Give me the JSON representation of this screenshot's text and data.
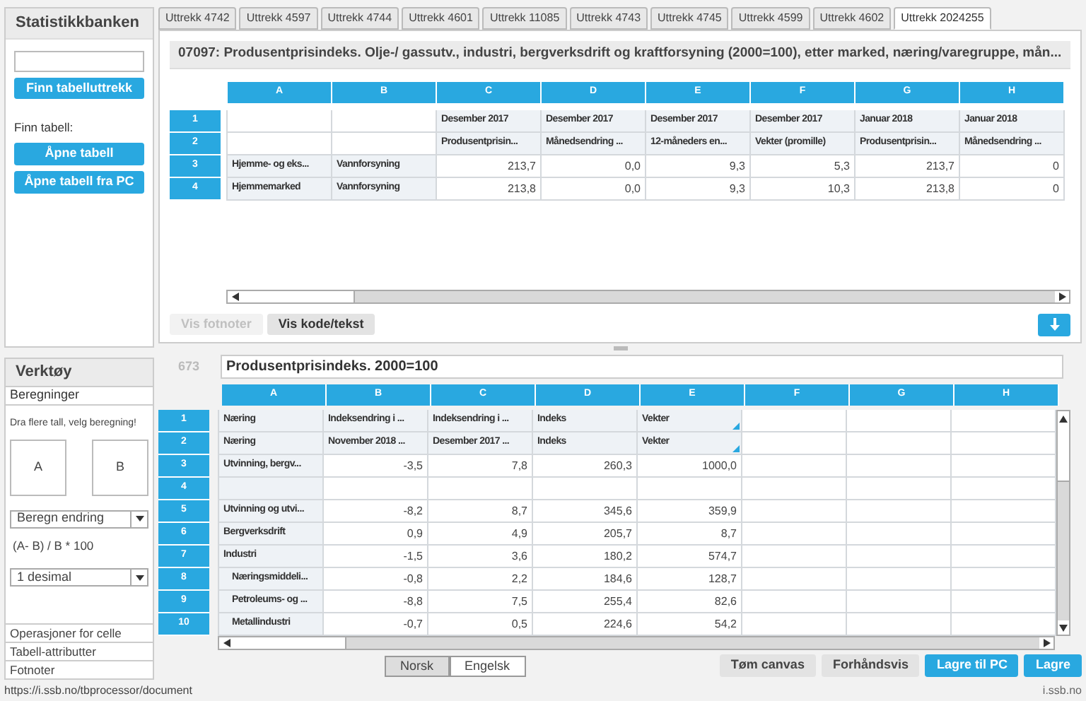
{
  "sidebar": {
    "title": "Statistikkbanken",
    "find_button": "Finn tabelluttrekk",
    "find_label": "Finn tabell:",
    "buttons": [
      "Åpne tabell",
      "Åpne tabell fra PC"
    ]
  },
  "tabs": [
    {
      "label": "Uttrekk 4742",
      "selected": false
    },
    {
      "label": "Uttrekk 4597",
      "selected": false
    },
    {
      "label": "Uttrekk 4744",
      "selected": false
    },
    {
      "label": "Uttrekk 4601",
      "selected": false
    },
    {
      "label": "Uttrekk 11085",
      "selected": false
    },
    {
      "label": "Uttrekk 4743",
      "selected": false
    },
    {
      "label": "Uttrekk 4745",
      "selected": false
    },
    {
      "label": "Uttrekk 4599",
      "selected": false
    },
    {
      "label": "Uttrekk 4602",
      "selected": false
    },
    {
      "label": "Uttrekk 2024255",
      "selected": true
    }
  ],
  "top_table": {
    "title": "07097: Produsentprisindeks. Olje-/ gassutv., industri, bergverksdrift og kraftforsyning (2000=100), etter marked, næring/varegruppe, mån...",
    "columns": [
      "A",
      "B",
      "C",
      "D",
      "E",
      "F",
      "G",
      "H"
    ],
    "rows": [
      {
        "number": "1",
        "cells": [
          null,
          null,
          {
            "kind": "head",
            "text": "Desember 2017"
          },
          {
            "kind": "head",
            "text": "Desember 2017"
          },
          {
            "kind": "head",
            "text": "Desember 2017"
          },
          {
            "kind": "head",
            "text": "Desember 2017"
          },
          {
            "kind": "head",
            "text": "Januar 2018"
          },
          {
            "kind": "head",
            "text": "Januar 2018"
          }
        ]
      },
      {
        "number": "2",
        "cells": [
          null,
          null,
          {
            "kind": "head",
            "text": "Produsentprisin..."
          },
          {
            "kind": "head",
            "text": "Månedsendring ..."
          },
          {
            "kind": "head",
            "text": "12-måneders en..."
          },
          {
            "kind": "head",
            "text": "Vekter (promille)"
          },
          {
            "kind": "head",
            "text": "Produsentprisin..."
          },
          {
            "kind": "head",
            "text": "Månedsendring ..."
          }
        ]
      },
      {
        "number": "3",
        "cells": [
          {
            "kind": "head",
            "text": "Hjemme- og eks..."
          },
          {
            "kind": "head",
            "text": "Vannforsyning"
          },
          {
            "kind": "num",
            "text": "213,7"
          },
          {
            "kind": "num",
            "text": "0,0"
          },
          {
            "kind": "num",
            "text": "9,3"
          },
          {
            "kind": "num",
            "text": "5,3"
          },
          {
            "kind": "num",
            "text": "213,7"
          },
          {
            "kind": "num",
            "text": "0"
          }
        ]
      },
      {
        "number": "4",
        "cells": [
          {
            "kind": "head",
            "text": "Hjemmemarked"
          },
          {
            "kind": "head",
            "text": "Vannforsyning"
          },
          {
            "kind": "num",
            "text": "213,8"
          },
          {
            "kind": "num",
            "text": "0,0"
          },
          {
            "kind": "num",
            "text": "9,3"
          },
          {
            "kind": "num",
            "text": "10,3"
          },
          {
            "kind": "num",
            "text": "213,8"
          },
          {
            "kind": "num",
            "text": "0"
          }
        ]
      }
    ],
    "buttons": [
      {
        "label": "Vis fotnoter",
        "disabled": true
      },
      {
        "label": "Vis kode/tekst",
        "disabled": false
      }
    ]
  },
  "tools": {
    "title": "Verktøy",
    "section": "Beregninger",
    "hint": "Dra flere tall, velg beregning!",
    "drop_boxes": [
      "A",
      "B"
    ],
    "operation": "Beregn endring",
    "formula": "(A- B) / B * 100",
    "decimals": "1 desimal",
    "sections": [
      "Operasjoner for celle",
      "Tabell-attributter",
      "Fotnoter"
    ]
  },
  "canvas": {
    "row_count": "673",
    "title": "Produsentprisindeks. 2000=100",
    "columns": [
      "A",
      "B",
      "C",
      "D",
      "E",
      "F",
      "G",
      "H"
    ],
    "rows": [
      {
        "number": "1",
        "cells": [
          {
            "kind": "head",
            "text": "Næring"
          },
          {
            "kind": "head",
            "text": "Indeksendring i ..."
          },
          {
            "kind": "head",
            "text": "Indeksendring i ..."
          },
          {
            "kind": "head",
            "text": "Indeks"
          },
          {
            "kind": "head",
            "text": "Vekter",
            "flagged": true
          },
          null,
          null,
          null
        ]
      },
      {
        "number": "2",
        "cells": [
          {
            "kind": "head",
            "text": "Næring"
          },
          {
            "kind": "head",
            "text": "November 2018 ..."
          },
          {
            "kind": "head",
            "text": "Desember 2017 ..."
          },
          {
            "kind": "head",
            "text": "Indeks"
          },
          {
            "kind": "head",
            "text": "Vekter",
            "flagged": true
          },
          null,
          null,
          null
        ]
      },
      {
        "number": "3",
        "cells": [
          {
            "kind": "head",
            "text": "Utvinning, bergv..."
          },
          {
            "kind": "num",
            "text": "-3,5"
          },
          {
            "kind": "num",
            "text": "7,8"
          },
          {
            "kind": "num",
            "text": "260,3"
          },
          {
            "kind": "num",
            "text": "1000,0"
          },
          null,
          null,
          null
        ]
      },
      {
        "number": "4",
        "cells": [
          {
            "kind": "head"
          },
          null,
          null,
          null,
          null,
          null,
          null,
          null
        ]
      },
      {
        "number": "5",
        "cells": [
          {
            "kind": "head",
            "text": "Utvinning og utvi..."
          },
          {
            "kind": "num",
            "text": "-8,2"
          },
          {
            "kind": "num",
            "text": "8,7"
          },
          {
            "kind": "num",
            "text": "345,6"
          },
          {
            "kind": "num",
            "text": "359,9"
          },
          null,
          null,
          null
        ]
      },
      {
        "number": "6",
        "cells": [
          {
            "kind": "head",
            "text": "Bergverksdrift"
          },
          {
            "kind": "num",
            "text": "0,9"
          },
          {
            "kind": "num",
            "text": "4,9"
          },
          {
            "kind": "num",
            "text": "205,7"
          },
          {
            "kind": "num",
            "text": "8,7"
          },
          null,
          null,
          null
        ]
      },
      {
        "number": "7",
        "cells": [
          {
            "kind": "head",
            "text": "Industri"
          },
          {
            "kind": "num",
            "text": "-1,5"
          },
          {
            "kind": "num",
            "text": "3,6"
          },
          {
            "kind": "num",
            "text": "180,2"
          },
          {
            "kind": "num",
            "text": "574,7"
          },
          null,
          null,
          null
        ]
      },
      {
        "number": "8",
        "cells": [
          {
            "kind": "head",
            "text": "Næringsmiddeli...",
            "indented": true
          },
          {
            "kind": "num",
            "text": "-0,8"
          },
          {
            "kind": "num",
            "text": "2,2"
          },
          {
            "kind": "num",
            "text": "184,6"
          },
          {
            "kind": "num",
            "text": "128,7"
          },
          null,
          null,
          null
        ]
      },
      {
        "number": "9",
        "cells": [
          {
            "kind": "head",
            "text": "Petroleums- og ...",
            "indented": true
          },
          {
            "kind": "num",
            "text": "-8,8"
          },
          {
            "kind": "num",
            "text": "7,5"
          },
          {
            "kind": "num",
            "text": "255,4"
          },
          {
            "kind": "num",
            "text": "82,6"
          },
          null,
          null,
          null
        ]
      },
      {
        "number": "10",
        "cells": [
          {
            "kind": "head",
            "text": "Metallindustri",
            "indented": true
          },
          {
            "kind": "num",
            "text": "-0,7"
          },
          {
            "kind": "num",
            "text": "0,5"
          },
          {
            "kind": "num",
            "text": "224,6"
          },
          {
            "kind": "num",
            "text": "54,2"
          },
          null,
          null,
          null
        ]
      }
    ],
    "languages": [
      {
        "label": "Norsk",
        "selected": true
      },
      {
        "label": "Engelsk",
        "selected": false
      }
    ],
    "buttons": [
      {
        "label": "Tøm canvas",
        "kind": "secondary"
      },
      {
        "label": "Forhåndsvis",
        "kind": "secondary"
      },
      {
        "label": "Lagre til PC",
        "kind": "primary"
      },
      {
        "label": "Lagre",
        "kind": "primary"
      }
    ]
  },
  "status_bar": {
    "url": "https://i.ssb.no/tbprocessor/document",
    "host": "i.ssb.no"
  }
}
